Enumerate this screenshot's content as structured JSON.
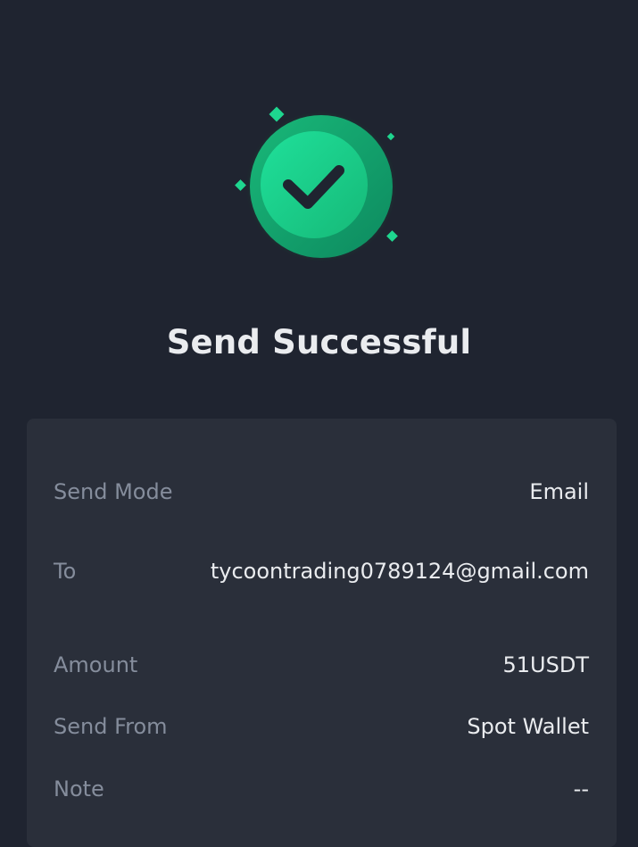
{
  "status": {
    "title": "Send Successful",
    "icon": "check-circle-icon",
    "accent_color": "#1ed68f"
  },
  "details": {
    "rows": [
      {
        "label": "Send Mode",
        "value": "Email"
      },
      {
        "label": "To",
        "value": "tycoontrading0789124@gmail.com"
      },
      {
        "label": "Amount",
        "value": "51USDT"
      },
      {
        "label": "Send From",
        "value": "Spot Wallet"
      },
      {
        "label": "Note",
        "value": "--"
      }
    ]
  }
}
